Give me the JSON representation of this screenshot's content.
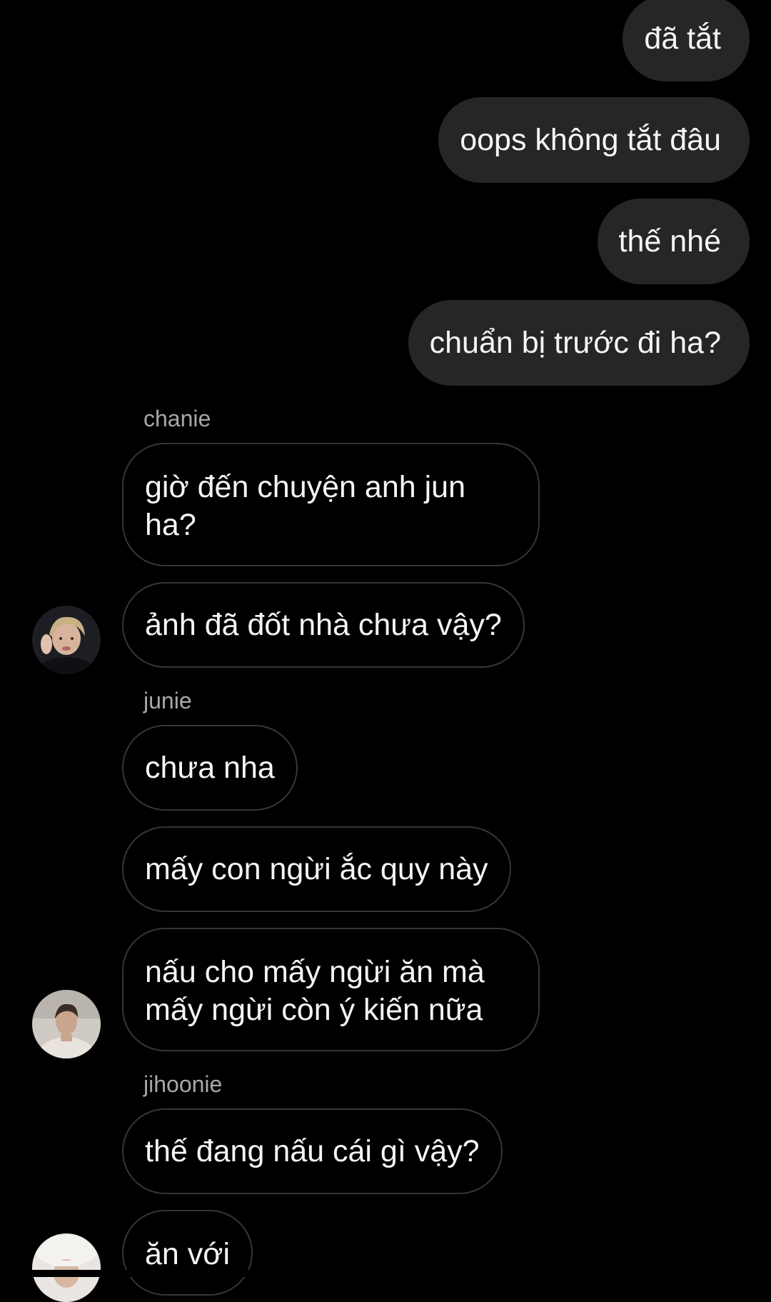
{
  "outgoing": [
    {
      "text": "đã tắt"
    },
    {
      "text": "oops không tắt đâu"
    },
    {
      "text": "thế nhé"
    },
    {
      "text": "chuẩn bị trước đi ha?"
    }
  ],
  "groups": [
    {
      "sender": "chanie",
      "messages": [
        {
          "lines": [
            "giờ đến chuyện anh jun",
            "ha?"
          ]
        },
        {
          "text": "ảnh đã đốt nhà chưa vậy?"
        }
      ]
    },
    {
      "sender": "junie",
      "messages": [
        {
          "text": "chưa nha"
        },
        {
          "text": "mấy con ngừi ắc quy này"
        },
        {
          "lines": [
            "nấu cho mấy ngừi ăn mà",
            "mấy ngừi còn ý kiến nữa"
          ]
        }
      ]
    },
    {
      "sender": "jihoonie",
      "messages": [
        {
          "text": "thế đang nấu cái gì vậy?"
        },
        {
          "text": "ăn với"
        }
      ]
    }
  ],
  "colors": {
    "background": "#000000",
    "outgoing_bubble": "#262626",
    "incoming_border": "#363636",
    "sender_text": "#a8a8a8",
    "message_text": "#f5f5f5"
  }
}
